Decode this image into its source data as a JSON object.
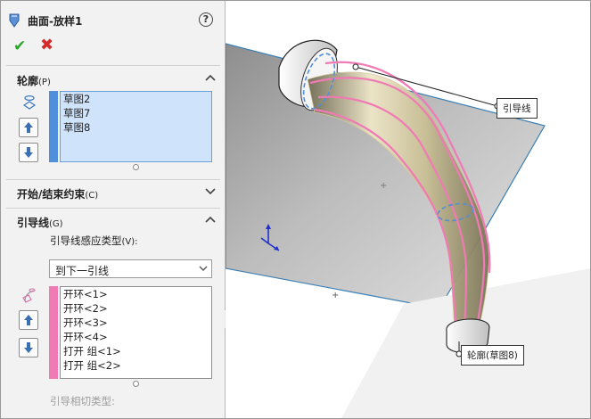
{
  "header": {
    "title": "曲面-放样1",
    "help_glyph": "?",
    "ok_glyph": "✔",
    "cancel_glyph": "✖"
  },
  "profiles_section": {
    "title": "轮廓",
    "shortcut": "(P)",
    "items": [
      "草图2",
      "草图7",
      "草图8"
    ]
  },
  "start_end_section": {
    "title": "开始/结束约束",
    "shortcut": "(C)"
  },
  "guides_section": {
    "title": "引导线",
    "shortcut": "(G)",
    "influence_label": "引导线感应类型",
    "influence_shortcut": "(V):",
    "influence_value": "到下一引线",
    "items": [
      "开环<1>",
      "开环<2>",
      "开环<3>",
      "开环<4>",
      "打开 组<1>",
      "打开 组<2>"
    ],
    "tangency_label": "引导相切类型:"
  },
  "viewport": {
    "callout_guide": "引导线",
    "callout_profile": "轮廓(草图8)"
  },
  "colors": {
    "accent_blue": "#4f8fdc",
    "selection_bg": "#cfe4fa",
    "guide_pink": "#f07ab4",
    "ok_green": "#2aa52a",
    "cancel_red": "#d62a2a"
  }
}
